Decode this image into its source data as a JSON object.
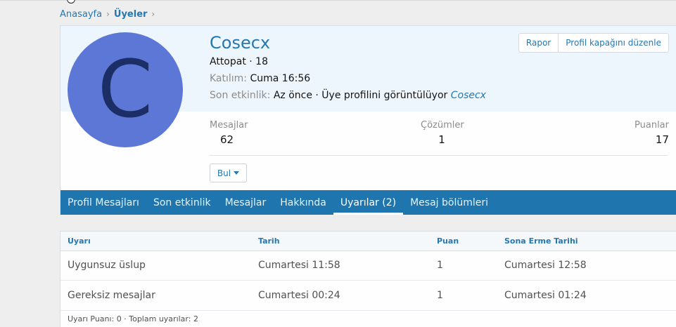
{
  "breadcrumb": [
    {
      "label": "Anasayfa"
    },
    {
      "label": "Üyeler"
    }
  ],
  "profile": {
    "avatar_letter": "C",
    "avatar_color": "#5d77d6",
    "username": "Cosecx",
    "title_line": "Attopat · 18",
    "joined_label": "Katılım:",
    "joined_value": "Cuma 16:56",
    "last_activity_label": "Son etkinlik:",
    "last_activity_value": "Az önce · Üye profilini görüntülüyor",
    "last_activity_link": "Cosecx",
    "buttons": {
      "report": "Rapor",
      "edit_cover": "Profil kapağını düzenle"
    },
    "stats": [
      {
        "label": "Mesajlar",
        "value": "62"
      },
      {
        "label": "Çözümler",
        "value": "1"
      },
      {
        "label": "Puanlar",
        "value": "17"
      }
    ],
    "find_label": "Bul"
  },
  "tabs": [
    {
      "label": "Profil Mesajları",
      "active": false
    },
    {
      "label": "Son etkinlik",
      "active": false
    },
    {
      "label": "Mesajlar",
      "active": false
    },
    {
      "label": "Hakkında",
      "active": false
    },
    {
      "label": "Uyarılar (2)",
      "active": true
    },
    {
      "label": "Mesaj bölümleri",
      "active": false
    }
  ],
  "warnings": {
    "columns": [
      "Uyarı",
      "Tarih",
      "Puan",
      "Sona Erme Tarihi"
    ],
    "rows": [
      [
        "Uygunsuz üslup",
        "Cumartesi 11:58",
        "1",
        "Cumartesi 12:58"
      ],
      [
        "Gereksiz mesajlar",
        "Cumartesi 00:24",
        "1",
        "Cumartesi 01:24"
      ]
    ],
    "footer": "Uyarı Puanı: 0 · Toplam uyarılar: 2"
  },
  "colors": {
    "accent": "#2577b1",
    "tab_bar": "#1f76ae",
    "cover": "#edf6fd"
  }
}
